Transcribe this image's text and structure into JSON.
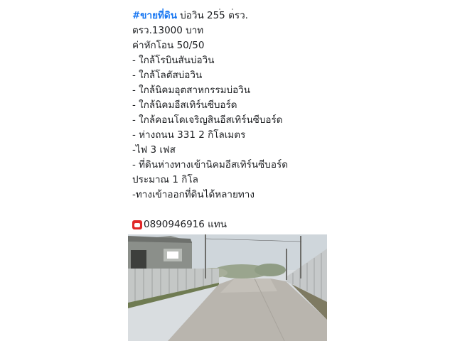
{
  "post": {
    "hashtag": "#ขายที่ดิน",
    "title_rest": " บ่อวิน 255 ตรว.",
    "lines": [
      "ตรว.13000 บาท",
      "ค่าหักโอน 50/50",
      "- ใกล้โรบินสันบ่อวิน",
      "- ใกล้โลตัสบ่อวิน",
      "- ใกล้นิคมอุตสาหกรรมบ่อวิน",
      "- ใกล้นิคมอีสเทิร์นซีบอร์ด",
      "- ใกล้คอนโดเจริญสินอีสเทิร์นซีบอร์ด",
      "- ห่างถนน 331   2 กิโลเมตร",
      "-ไฟ 3 เฟส",
      "- ที่ดินห่างทางเข้านิคมอีสเทิร์นซีบอร์ด",
      "ประมาณ 1 กิโล",
      "-ทางเข้าออกที่ดินได้หลายทาง"
    ],
    "phone": "0890946916 แทน",
    "phone_icon": "telephone-icon"
  },
  "colors": {
    "hashtag": "#1877f2",
    "text": "#1c1e21",
    "phone_icon": "#e02828"
  }
}
